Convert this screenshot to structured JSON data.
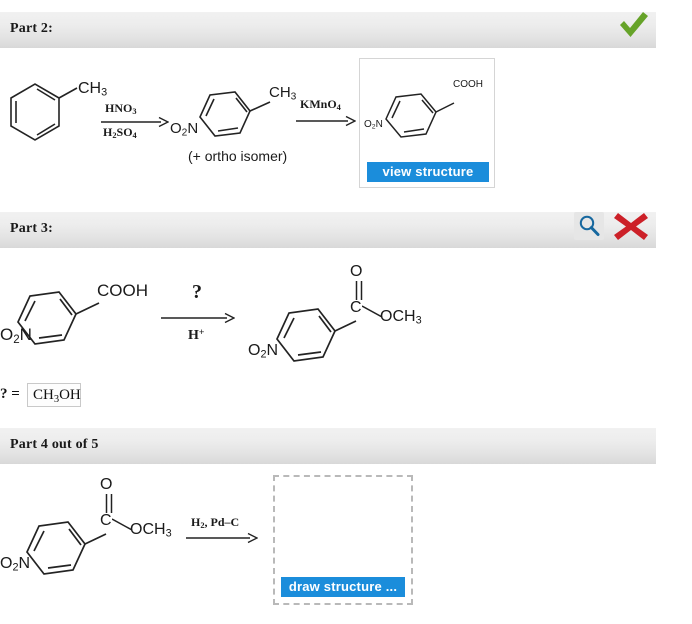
{
  "page": {
    "background": "#ffffff",
    "accent_blue": "#1b8ddb",
    "bar_gradient_top": "#f1f1f1",
    "bar_gradient_bottom": "#d8d8d8",
    "check_color": "#66a329",
    "cross_color": "#cc2028",
    "magnifier_color": "#17689f"
  },
  "parts": [
    {
      "id": "part2",
      "label": "Part 2:",
      "status": "correct",
      "status_icon": "green-check-icon"
    },
    {
      "id": "part3",
      "label": "Part 3:",
      "status": "incorrect",
      "status_icon": "red-cross-icon",
      "hint_icon": "magnifier-icon"
    },
    {
      "id": "part4",
      "label": "Part 4 out of 5",
      "status": "pending"
    }
  ],
  "part2_scheme": {
    "reactant_label": "CH",
    "reactant_sub": "3",
    "reagent1_top_a": "HNO",
    "reagent1_top_b": "3",
    "reagent1_bottom_a": "H",
    "reagent1_bottom_b": "2",
    "reagent1_bottom_c": "SO",
    "reagent1_bottom_d": "4",
    "intermediate_nitro_a": "O",
    "intermediate_nitro_b": "2",
    "intermediate_nitro_c": "N",
    "intermediate_methyl": "CH",
    "intermediate_methyl_sub": "3",
    "isomer_note": "(+ ortho isomer)",
    "reagent2_a": "KMnO",
    "reagent2_b": "4",
    "product_cooh": "COOH",
    "product_nitro_a": "O",
    "product_nitro_b": "2",
    "product_nitro_c": "N",
    "view_button": "view structure"
  },
  "part3_scheme": {
    "reactant_cooh": "COOH",
    "reactant_nitro_a": "O",
    "reactant_nitro_b": "2",
    "reactant_nitro_c": "N",
    "reagent_top": "?",
    "reagent_bottom_a": "H",
    "reagent_bottom_b": "+",
    "product_o": "O",
    "product_c": "C",
    "product_ocH3_a": "OCH",
    "product_ocH3_b": "3",
    "product_nitro_a": "O",
    "product_nitro_b": "2",
    "product_nitro_c": "N"
  },
  "part3_answer": {
    "prompt": "? =",
    "value_a": "CH",
    "value_b": "3",
    "value_c": "OH"
  },
  "part4_scheme": {
    "reactant_o": "O",
    "reactant_c": "C",
    "reactant_ocH3_a": "OCH",
    "reactant_ocH3_b": "3",
    "reactant_nitro_a": "O",
    "reactant_nitro_b": "2",
    "reactant_nitro_c": "N",
    "reagent_a": "H",
    "reagent_b": "2",
    "reagent_c": ", Pd–C",
    "draw_button": "draw structure ..."
  }
}
